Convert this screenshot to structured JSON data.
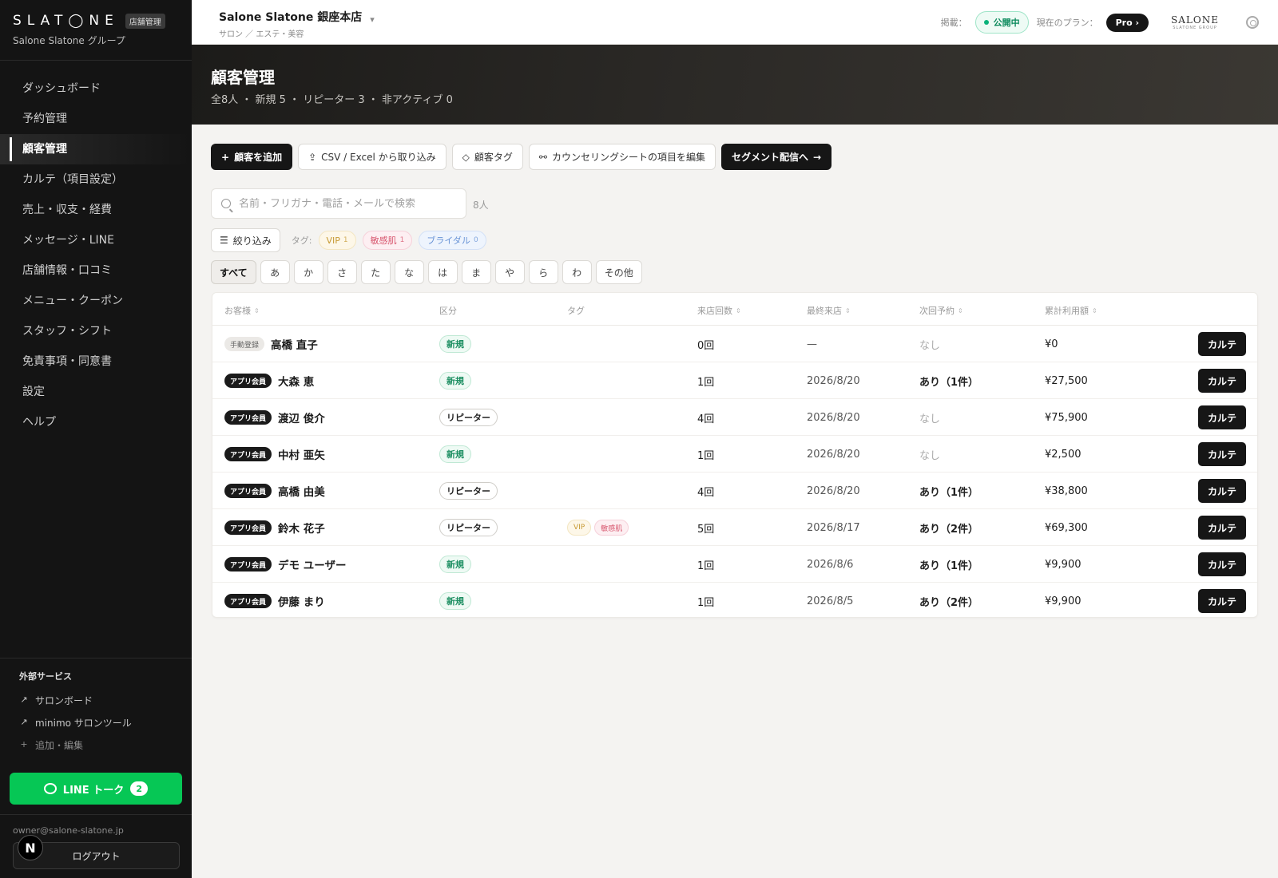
{
  "sidebar": {
    "logo": "SLAT◯NE",
    "badge": "店舗管理",
    "group": "Salone Slatone グループ",
    "nav": [
      {
        "label": "ダッシュボード",
        "active": false
      },
      {
        "label": "予約管理",
        "active": false
      },
      {
        "label": "顧客管理",
        "active": true
      },
      {
        "label": "カルテ（項目設定）",
        "active": false
      },
      {
        "label": "売上・収支・経費",
        "active": false
      },
      {
        "label": "メッセージ・LINE",
        "active": false
      },
      {
        "label": "店舗情報・口コミ",
        "active": false
      },
      {
        "label": "メニュー・クーポン",
        "active": false
      },
      {
        "label": "スタッフ・シフト",
        "active": false
      },
      {
        "label": "免責事項・同意書",
        "active": false
      },
      {
        "label": "設定",
        "active": false
      },
      {
        "label": "ヘルプ",
        "active": false
      }
    ],
    "external_title": "外部サービス",
    "external": [
      "サロンボード",
      "minimo サロンツール"
    ],
    "external_add": "追加・編集",
    "line_label": "LINE トーク",
    "line_count": "2",
    "email": "owner@salone-slatone.jp",
    "logout": "ログアウト",
    "avatar_letter": "N"
  },
  "header": {
    "store_name": "Salone Slatone 銀座本店",
    "store_category": "サロン ／ エステ・美容",
    "publish_label": "掲載：",
    "publish_status": "公開中",
    "plan_label": "現在のプラン：",
    "plan": "Pro",
    "logo_main": "SALONE",
    "logo_sub": "SLATONE GROUP"
  },
  "banner": {
    "title": "顧客管理",
    "summary": "全8人 ・ 新規 5 ・ リピーター 3 ・ 非アクティブ 0"
  },
  "toolbar": {
    "add": "顧客を追加",
    "import": "CSV / Excel から取り込み",
    "tags": "顧客タグ",
    "counseling": "カウンセリングシートの項目を編集",
    "segment": "セグメント配信へ"
  },
  "search": {
    "placeholder": "名前・フリガナ・電話・メールで検索",
    "count": "8人"
  },
  "filters": {
    "button": "絞り込み",
    "tag_label": "タグ:",
    "tags": [
      {
        "label": "VIP",
        "count": "1"
      },
      {
        "label": "敏感肌",
        "count": "1"
      },
      {
        "label": "ブライダル",
        "count": "0"
      }
    ]
  },
  "kana": [
    "すべて",
    "あ",
    "か",
    "さ",
    "た",
    "な",
    "は",
    "ま",
    "や",
    "ら",
    "わ",
    "その他"
  ],
  "table": {
    "headers": {
      "customer": "お客様",
      "segment": "区分",
      "tags": "タグ",
      "visits": "来店回数",
      "last_visit": "最終来店",
      "next": "次回予約",
      "total": "累計利用額"
    },
    "action_label": "カルテ",
    "rows": [
      {
        "source": "手動登録",
        "name": "高橋 直子",
        "segment": "新規",
        "tags": [],
        "visits": "0回",
        "last_visit": "—",
        "next": "なし",
        "total": "¥0"
      },
      {
        "source": "アプリ会員",
        "name": "大森 恵",
        "segment": "新規",
        "tags": [],
        "visits": "1回",
        "last_visit": "2026/8/20",
        "next": "あり（1件）",
        "total": "¥27,500"
      },
      {
        "source": "アプリ会員",
        "name": "渡辺 俊介",
        "segment": "リピーター",
        "tags": [],
        "visits": "4回",
        "last_visit": "2026/8/20",
        "next": "なし",
        "total": "¥75,900"
      },
      {
        "source": "アプリ会員",
        "name": "中村 亜矢",
        "segment": "新規",
        "tags": [],
        "visits": "1回",
        "last_visit": "2026/8/20",
        "next": "なし",
        "total": "¥2,500"
      },
      {
        "source": "アプリ会員",
        "name": "高橋 由美",
        "segment": "リピーター",
        "tags": [],
        "visits": "4回",
        "last_visit": "2026/8/20",
        "next": "あり（1件）",
        "total": "¥38,800"
      },
      {
        "source": "アプリ会員",
        "name": "鈴木 花子",
        "segment": "リピーター",
        "tags": [
          "VIP",
          "敏感肌"
        ],
        "visits": "5回",
        "last_visit": "2026/8/17",
        "next": "あり（2件）",
        "total": "¥69,300"
      },
      {
        "source": "アプリ会員",
        "name": "デモ ユーザー",
        "segment": "新規",
        "tags": [],
        "visits": "1回",
        "last_visit": "2026/8/6",
        "next": "あり（1件）",
        "total": "¥9,900"
      },
      {
        "source": "アプリ会員",
        "name": "伊藤 まり",
        "segment": "新規",
        "tags": [],
        "visits": "1回",
        "last_visit": "2026/8/5",
        "next": "あり（2件）",
        "total": "¥9,900"
      }
    ]
  }
}
